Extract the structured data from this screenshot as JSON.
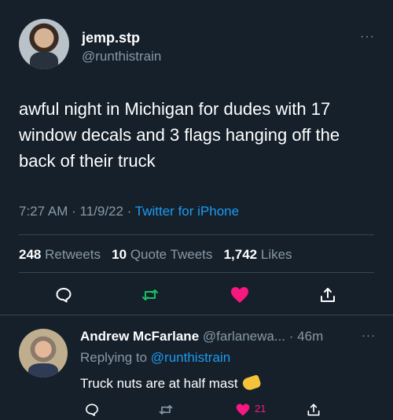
{
  "tweet": {
    "display_name": "jemp.stp",
    "handle": "@runthistrain",
    "text": "awful night in Michigan for dudes with 17 window decals and 3 flags hanging off the back of their truck",
    "time": "7:27 AM",
    "date": "11/9/22",
    "source": "Twitter for iPhone",
    "stats": {
      "retweets": "248",
      "retweets_label": "Retweets",
      "quotes": "10",
      "quotes_label": "Quote Tweets",
      "likes": "1,742",
      "likes_label": "Likes"
    },
    "more": "···"
  },
  "reply": {
    "display_name": "Andrew McFarlane",
    "handle": "@farlanewa...",
    "time": "46m",
    "replying_prefix": "Replying to",
    "replying_to": "@runthistrain",
    "text": "Truck nuts are at half mast",
    "like_count": "21",
    "more": "···"
  },
  "colors": {
    "background": "#15202b",
    "muted": "#8899a6",
    "link": "#1d9bf0",
    "retweet": "#17bf63",
    "like": "#f91880",
    "divider": "#38444d"
  },
  "icons": {
    "reply": "comment-icon",
    "retweet": "retweet-icon",
    "like": "heart-icon",
    "share": "share-icon",
    "more": "more-icon"
  }
}
